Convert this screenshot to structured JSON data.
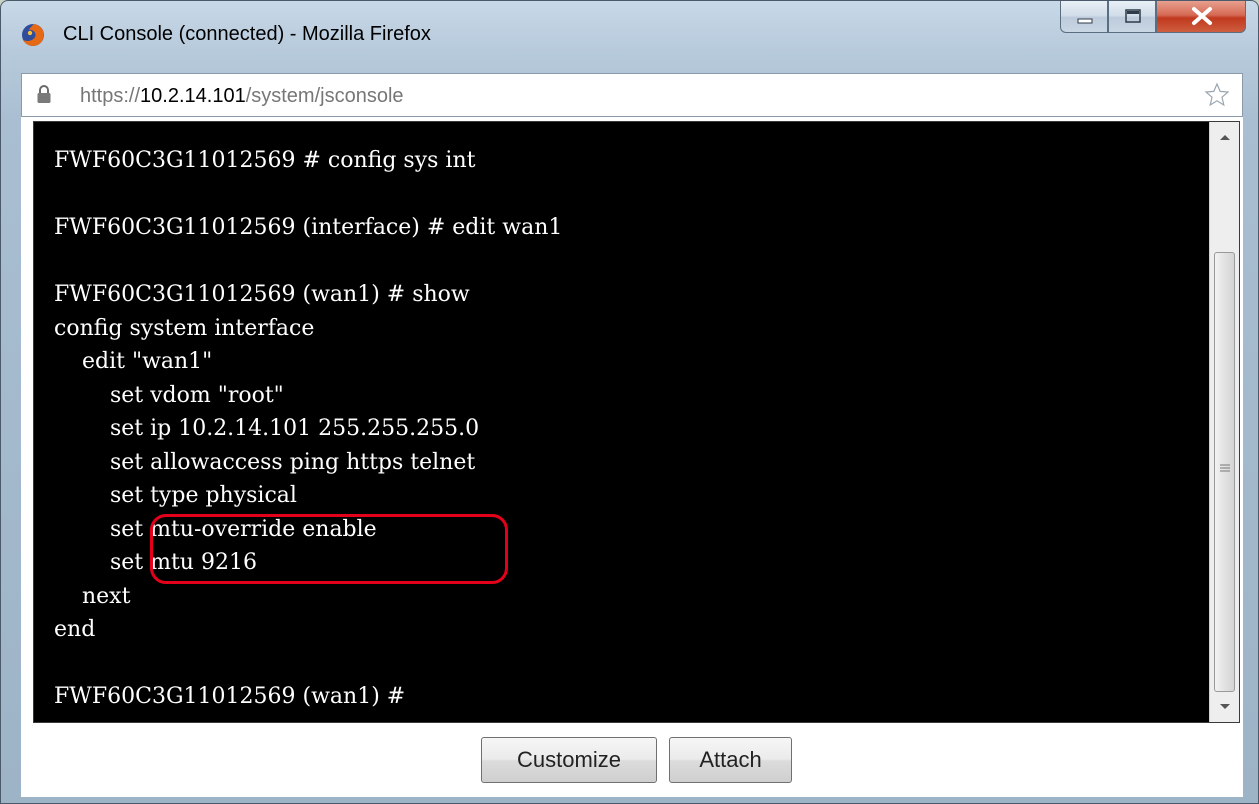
{
  "window": {
    "title": "CLI Console (connected) - Mozilla Firefox",
    "controls": {
      "minimize_icon": "minimize-icon",
      "maximize_icon": "maximize-icon",
      "close_icon": "close-icon"
    }
  },
  "address_bar": {
    "scheme": "https://",
    "host": "10.2.14.101",
    "path": "/system/jsconsole",
    "lock_icon": "lock-icon",
    "bookmark_icon": "star-icon"
  },
  "console": {
    "output": "FWF60C3G11012569 # config sys int\n\nFWF60C3G11012569 (interface) # edit wan1\n\nFWF60C3G11012569 (wan1) # show\nconfig system interface\n    edit \"wan1\"\n        set vdom \"root\"\n        set ip 10.2.14.101 255.255.255.0\n        set allowaccess ping https telnet\n        set type physical\n        set mtu-override enable\n        set mtu 9216\n    next\nend\n\nFWF60C3G11012569 (wan1) #"
  },
  "buttons": {
    "customize_label": "Customize",
    "attach_label": "Attach"
  },
  "colors": {
    "console_bg": "#000000",
    "console_fg": "#ffffff",
    "highlight": "#e4001b",
    "close_button": "#c0391f"
  }
}
